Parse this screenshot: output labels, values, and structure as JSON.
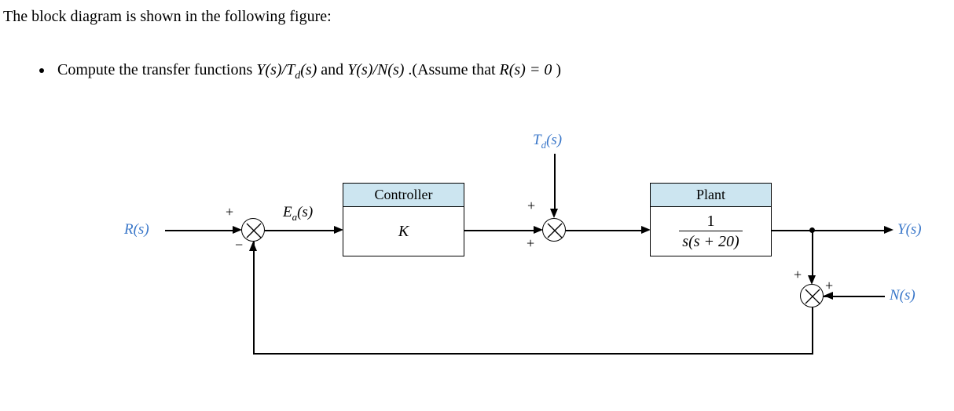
{
  "text": {
    "line1": "The block diagram is shown in the following figure:",
    "bullet_prefix": "Compute the transfer functions ",
    "tf1": "Y(s)/T",
    "tf1_sub": "d",
    "tf1_after": "(s)",
    "and": " and ",
    "tf2": "Y(s)/N(s)",
    "assume": ".(Assume that ",
    "rs_eq": "R(s) = 0",
    "close": ")"
  },
  "labels": {
    "R": "R(s)",
    "Ea": "E",
    "Ea_sub": "a",
    "Ea_after": "(s)",
    "Td": "T",
    "Td_sub": "d",
    "Td_after": "(s)",
    "Y": "Y(s)",
    "N": "N(s)",
    "Controller": "Controller",
    "Plant": "Plant",
    "K": "K",
    "plant_num": "1",
    "plant_den": "s(s + 20)"
  },
  "signs": {
    "plus": "+",
    "minus": "−"
  }
}
